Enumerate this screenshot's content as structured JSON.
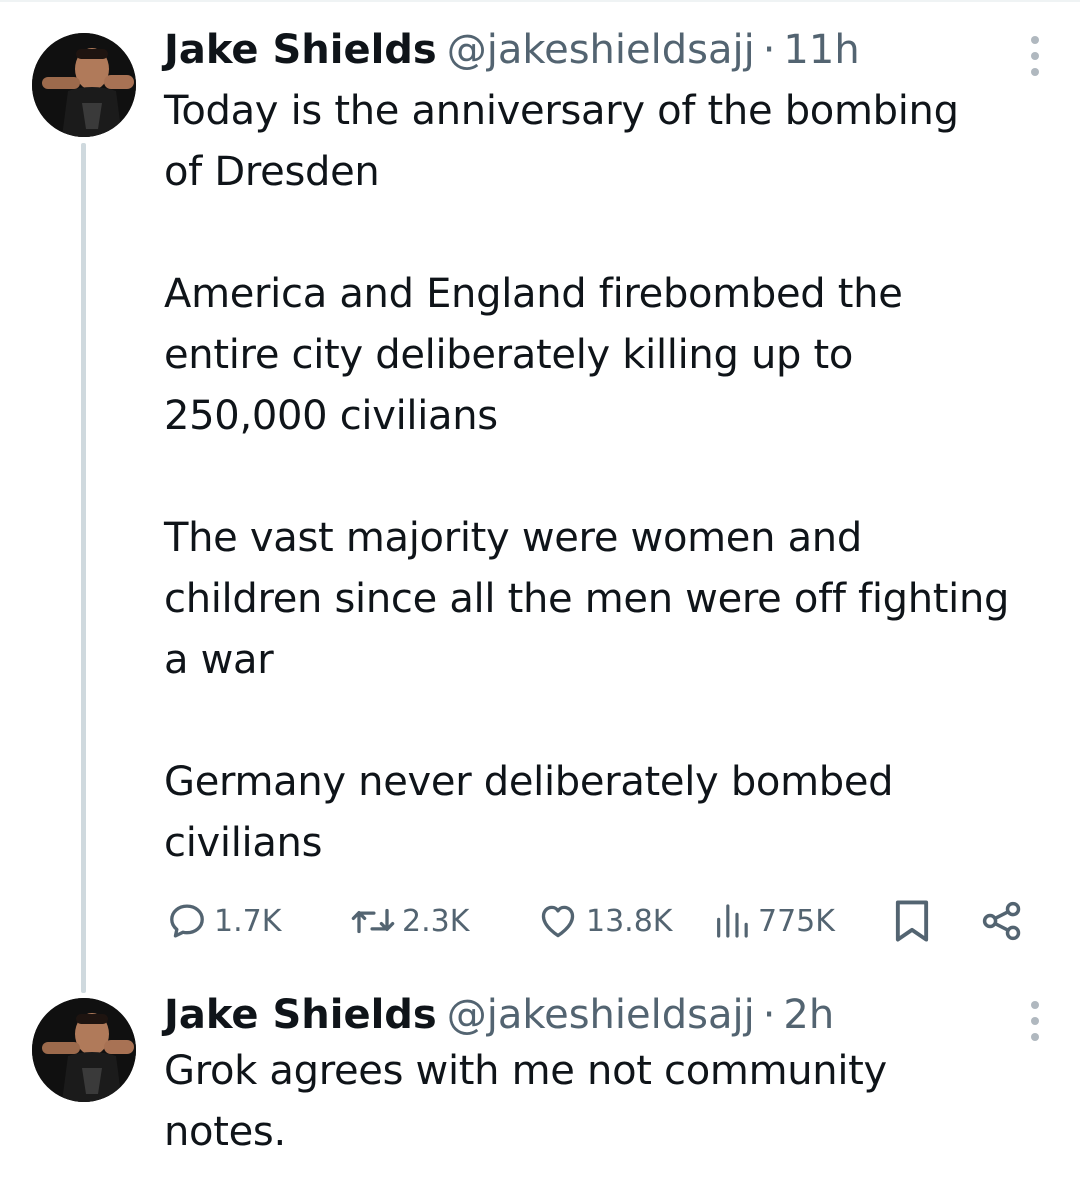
{
  "tweets": [
    {
      "author_name": "Jake Shields",
      "handle": "@jakeshieldsajj",
      "separator": "·",
      "time": "11h",
      "text": "Today is the anniversary of the bombing\nof Dresden\n\nAmerica and England firebombed the\nentire city deliberately killing up to\n250,000 civilians\n\nThe vast majority were women and\nchildren since all the men were off fighting\na war\n\nGermany never deliberately bombed\ncivilians",
      "actions": {
        "reply_count": "1.7K",
        "retweet_count": "2.3K",
        "like_count": "13.8K",
        "views_count": "775K"
      }
    },
    {
      "author_name": "Jake Shields",
      "handle": "@jakeshieldsajj",
      "separator": "·",
      "time": "2h",
      "text": "Grok agrees with me not community\nnotes."
    }
  ],
  "icons": {
    "reply": "reply-icon",
    "retweet": "retweet-icon",
    "like": "heart-icon",
    "views": "views-icon",
    "bookmark": "bookmark-icon",
    "share": "share-icon",
    "more": "more-options-icon"
  },
  "colors": {
    "text_primary": "#0f1419",
    "text_secondary": "#536471",
    "thread_line": "#cfd9de"
  }
}
